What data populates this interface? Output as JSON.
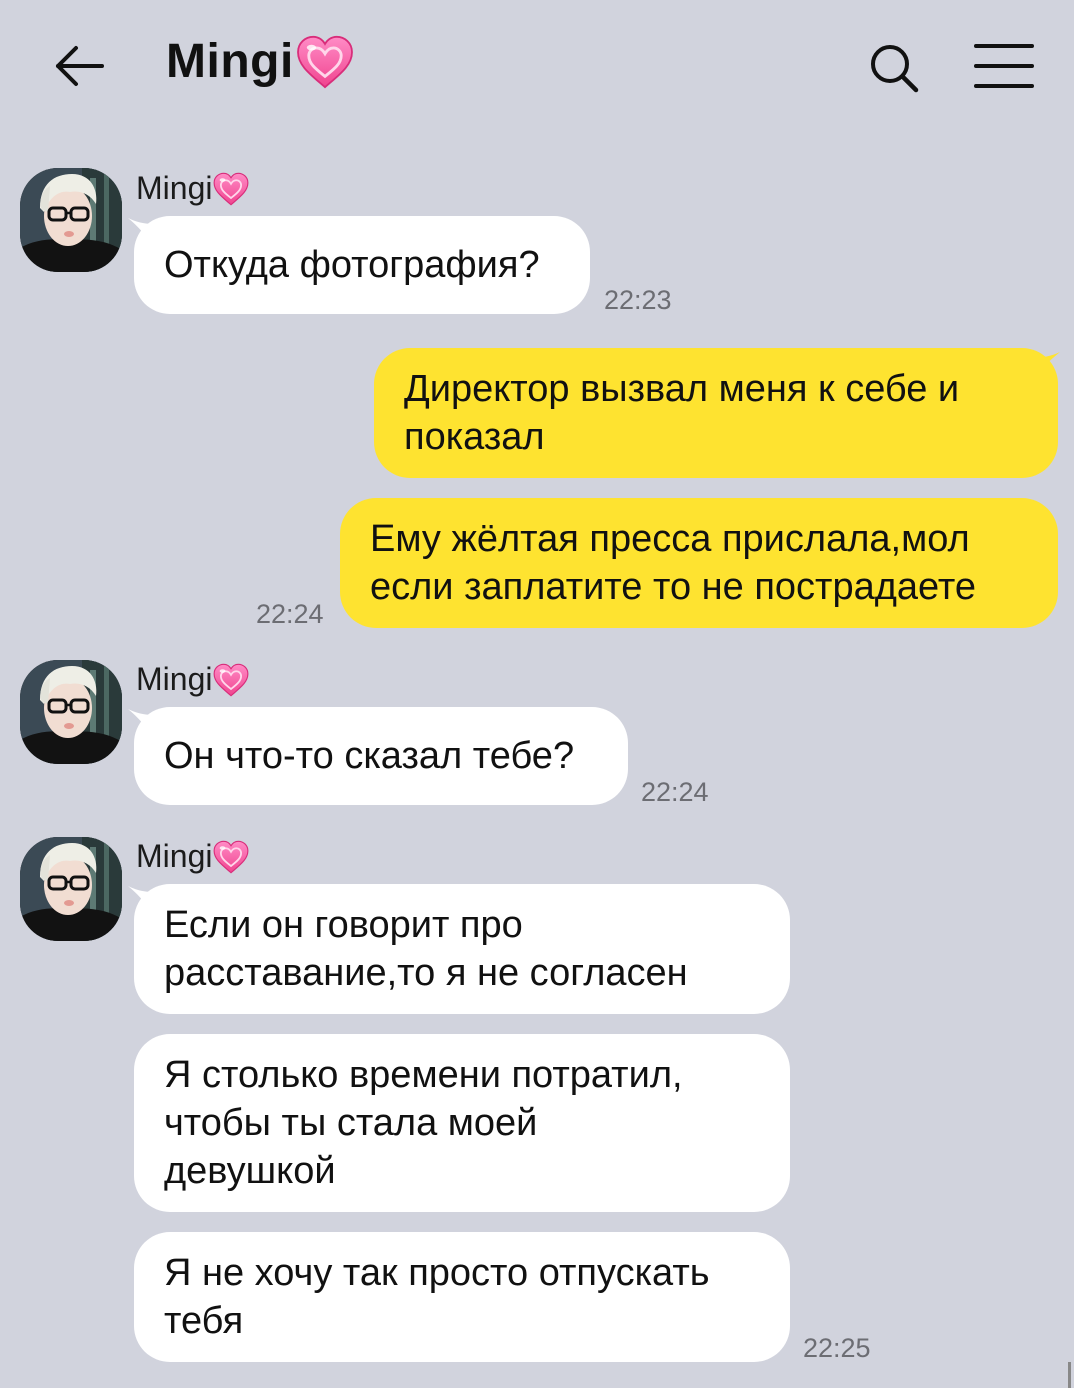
{
  "header": {
    "title": "Mingi",
    "title_emoji": "heart-emoji"
  },
  "icons": {
    "back": "arrow-left-icon",
    "search": "search-icon",
    "menu": "hamburger-menu-icon"
  },
  "colors": {
    "background": "#d1d3dd",
    "incoming_bubble": "#ffffff",
    "outgoing_bubble": "#fee330",
    "timestamp": "#6c6d73",
    "heart": "#ff4f9e"
  },
  "messages": [
    {
      "direction": "in",
      "sender": "Mingi",
      "lines": [
        "Откуда фотография?"
      ],
      "time": "22:23"
    },
    {
      "direction": "out",
      "lines": [
        "Директор вызвал меня к себе и",
        "показал"
      ],
      "time": ""
    },
    {
      "direction": "out",
      "lines": [
        "Ему жёлтая пресса прислала,мол",
        "если заплатите то не пострадаете"
      ],
      "time": "22:24"
    },
    {
      "direction": "in",
      "sender": "Mingi",
      "lines": [
        "Он что-то сказал тебе?"
      ],
      "time": "22:24"
    },
    {
      "direction": "in",
      "sender": "Mingi",
      "lines": [
        "Если он говорит про",
        "расставание,то я не согласен"
      ],
      "time": ""
    },
    {
      "direction": "in",
      "lines": [
        "Я столько времени потратил,",
        "чтобы ты стала моей",
        "девушкой"
      ],
      "time": ""
    },
    {
      "direction": "in",
      "lines": [
        "Я не хочу так просто отпускать",
        "тебя"
      ],
      "time": "22:25"
    }
  ]
}
